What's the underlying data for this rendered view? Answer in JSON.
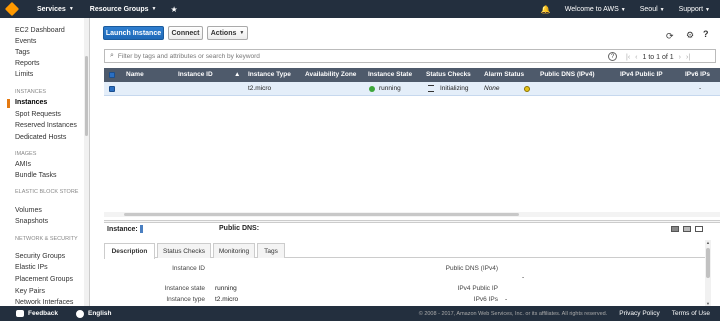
{
  "topnav": {
    "services": "Services",
    "resource_groups": "Resource Groups",
    "welcome": "Welcome to AWS",
    "region": "Seoul",
    "support": "Support"
  },
  "sidebar": {
    "items": [
      {
        "label": "EC2 Dashboard"
      },
      {
        "label": "Events"
      },
      {
        "label": "Tags"
      },
      {
        "label": "Reports"
      },
      {
        "label": "Limits"
      }
    ],
    "sections": [
      {
        "title": "INSTANCES",
        "items": [
          "Instances",
          "Spot Requests",
          "Reserved Instances",
          "Dedicated Hosts"
        ]
      },
      {
        "title": "IMAGES",
        "items": [
          "AMIs",
          "Bundle Tasks"
        ]
      },
      {
        "title": "ELASTIC BLOCK STORE",
        "items": [
          "Volumes",
          "Snapshots"
        ]
      },
      {
        "title": "NETWORK & SECURITY",
        "items": [
          "Security Groups",
          "Elastic IPs",
          "Placement Groups",
          "Key Pairs",
          "Network Interfaces"
        ]
      }
    ],
    "active": "Instances"
  },
  "toolbar": {
    "launch_label": "Launch Instance",
    "connect_label": "Connect",
    "actions_label": "Actions"
  },
  "search": {
    "placeholder": "Filter by tags and attributes or search by keyword",
    "help": "?",
    "pager": "1 to 1 of 1"
  },
  "table": {
    "columns": [
      "Name",
      "Instance ID",
      "Instance Type",
      "Availability Zone",
      "Instance State",
      "Status Checks",
      "Alarm Status",
      "Public DNS (IPv4)",
      "IPv4 Public IP",
      "IPv6 IPs"
    ],
    "rows": [
      {
        "name": "",
        "instance_id": "",
        "instance_type": "t2.micro",
        "availability_zone": "",
        "instance_state": "running",
        "status_checks": "Initializing",
        "alarm_status": "None",
        "public_dns": "",
        "ipv4": "",
        "ipv6": "-"
      }
    ]
  },
  "details": {
    "instance_label": "Instance:",
    "public_dns_label": "Public DNS:",
    "tabs": [
      "Description",
      "Status Checks",
      "Monitoring",
      "Tags"
    ],
    "active_tab": "Description",
    "left": [
      {
        "label": "Instance ID",
        "value": ""
      },
      {
        "label": "Instance state",
        "value": "running"
      },
      {
        "label": "Instance type",
        "value": "t2.micro"
      }
    ],
    "right": [
      {
        "label": "Public DNS (IPv4)",
        "value": "-"
      },
      {
        "label": "IPv4 Public IP",
        "value": ""
      },
      {
        "label": "IPv6 IPs",
        "value": "-"
      }
    ]
  },
  "footer": {
    "feedback": "Feedback",
    "language": "English",
    "copyright": "© 2008 - 2017, Amazon Web Services, Inc. or its affiliates. All rights reserved.",
    "privacy": "Privacy Policy",
    "terms": "Terms of Use"
  },
  "colors": {
    "nav_bg": "#232f3e",
    "accent_orange": "#e47911",
    "primary_blue": "#1f6ab8",
    "table_header": "#4e5a6b",
    "selected_row": "#e4eef9",
    "running_green": "#3da63a"
  }
}
